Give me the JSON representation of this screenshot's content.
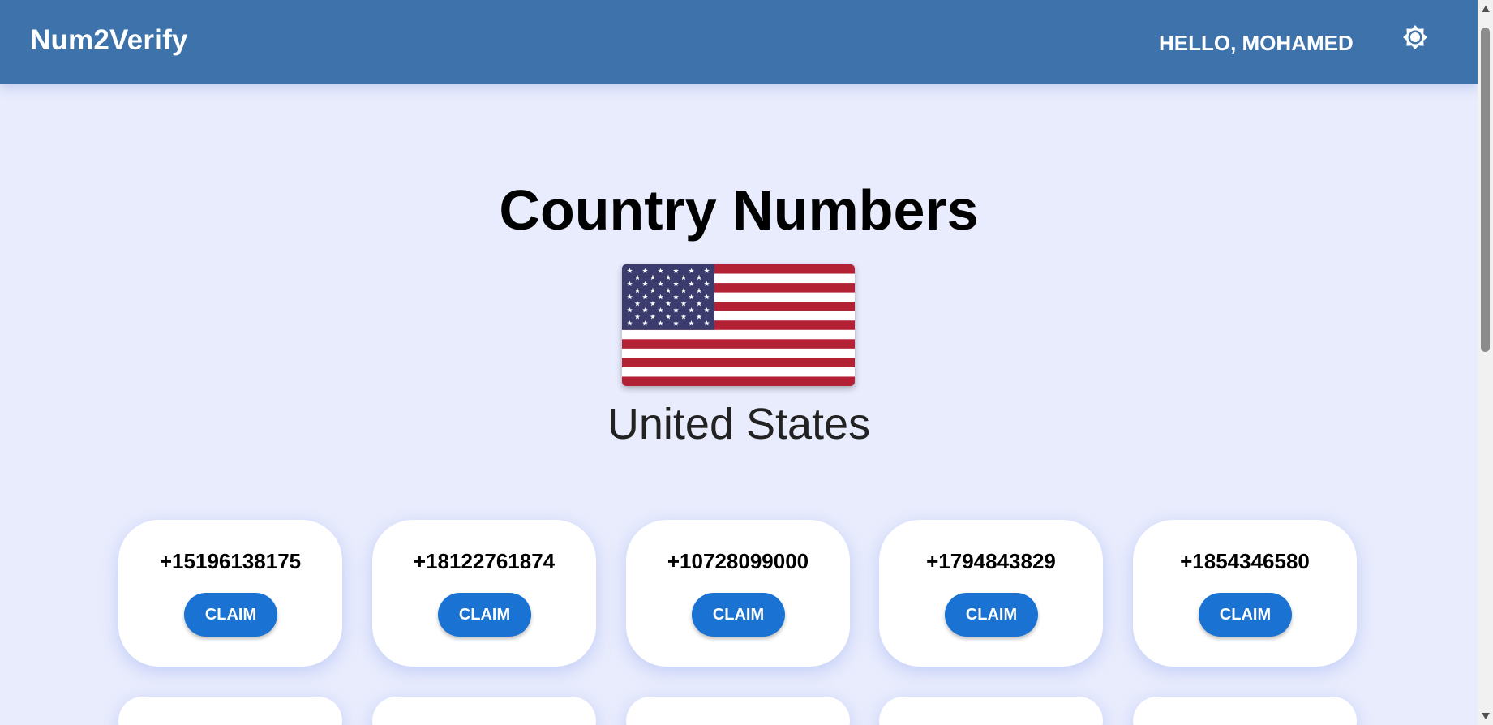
{
  "header": {
    "brand": "Num2Verify",
    "greeting": "HELLO, MOHAMED",
    "theme_icon": "brightness-icon"
  },
  "main": {
    "title": "Country Numbers",
    "flag_icon": "us-flag",
    "country": "United States",
    "numbers": [
      {
        "number": "+15196138175",
        "action": "CLAIM"
      },
      {
        "number": "+18122761874",
        "action": "CLAIM"
      },
      {
        "number": "+10728099000",
        "action": "CLAIM"
      },
      {
        "number": "+1794843829",
        "action": "CLAIM"
      },
      {
        "number": "+1854346580",
        "action": "CLAIM"
      }
    ]
  },
  "colors": {
    "header_bg": "#3d72ab",
    "page_bg": "#e9ecfd",
    "button": "#1a73d2"
  }
}
